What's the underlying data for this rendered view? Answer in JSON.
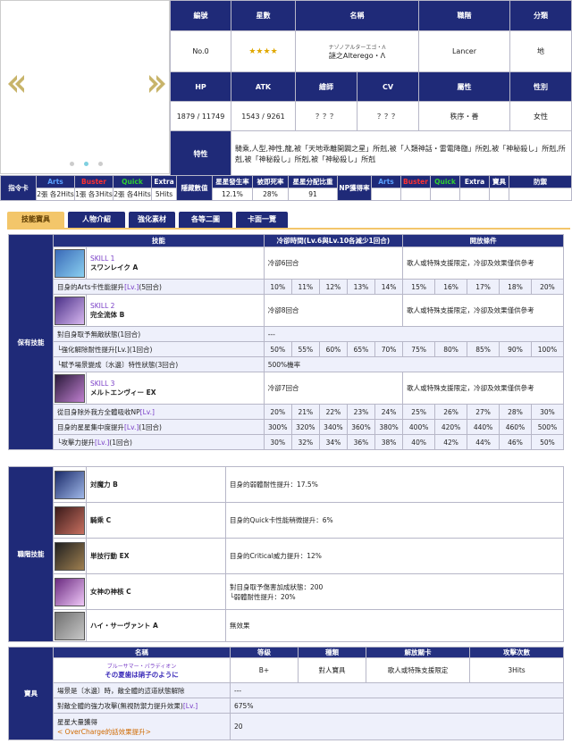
{
  "carousel": {
    "prev": "prev-arrow",
    "next": "next-arrow",
    "dots": 3,
    "active_dot": 1
  },
  "info": {
    "h_no": "編號",
    "h_star": "星數",
    "h_name": "名稱",
    "h_class": "職階",
    "h_cat": "分類",
    "no": "No.0",
    "stars": "★★★★",
    "name_jp": "ナゾノアルターエゴ・Λ",
    "name": "謎之Alterego・Λ",
    "class": "Lancer",
    "cat": "地",
    "h_hp": "HP",
    "h_atk": "ATK",
    "h_artist": "繪師",
    "h_cv": "CV",
    "h_attr": "屬性",
    "h_gender": "性別",
    "hp": "1879 / 11749",
    "atk": "1543 / 9261",
    "artist": "？？？",
    "cv": "？？？",
    "attr": "秩序・善",
    "gender": "女性",
    "h_trait": "特性",
    "trait": "騎乘,人型,神性,龍,被「天地乖離開闢之星」所剋,被「人類神話・雷電降臨」所剋,被「神秘殺し」所剋,所剋,被「神秘殺し」所剋,被「神秘殺し」所剋"
  },
  "cards": {
    "h_cmd": "指令卡",
    "arts": "Arts",
    "buster": "Buster",
    "quick": "Quick",
    "extra": "Extra",
    "arts_v": "2張 各2Hits",
    "buster_v": "1張 各3Hits",
    "quick_v": "2張 各4Hits",
    "extra_v": "5Hits",
    "h_hidden": "隱藏數值",
    "h_star_gen": "星星發生率",
    "h_death": "被即死率",
    "h_star_weight": "星星分配比重",
    "star_gen": "12.1%",
    "death": "28%",
    "star_weight": "91",
    "h_np": "NP獲得率",
    "np_arts": "Arts",
    "np_buster": "Buster",
    "np_quick": "Quick",
    "np_extra": "Extra",
    "np_np": "寶具",
    "np_def": "防禦"
  },
  "tabs": [
    "技能寶具",
    "人物介紹",
    "強化素材",
    "各等二圖",
    "卡面一覽"
  ],
  "skills": {
    "side": "保有技能",
    "h_skill": "技能",
    "h_cd": "冷卻時間(Lv.6與Lv.10各減少1回合)",
    "h_cond": "開放條件",
    "list": [
      {
        "tag": "SKILL 1",
        "name": "スワンレイク A",
        "cd": "冷卻6回合",
        "cond": "歌人或特殊支援限定，冷卻及效果僅供參考",
        "effects": [
          {
            "label": "目身的Arts卡性能提升[Lv.](5回合)",
            "vals": [
              "10%",
              "11%",
              "12%",
              "13%",
              "14%",
              "15%",
              "16%",
              "17%",
              "18%",
              "20%"
            ]
          }
        ]
      },
      {
        "tag": "SKILL 2",
        "name": "完全流体 B",
        "cd": "冷卻8回合",
        "cond": "歌人或特殊支援限定，冷卻及效果僅供參考",
        "effects": [
          {
            "label": "對自身取予無敵狀態(1回合)",
            "fixed": "---"
          },
          {
            "label": "└強化解除耐性提升[Lv.](1回合)",
            "vals": [
              "50%",
              "55%",
              "60%",
              "65%",
              "70%",
              "75%",
              "80%",
              "85%",
              "90%",
              "100%"
            ]
          },
          {
            "label": "└賦予場景變成〔水邊〕特性狀態(3回合)",
            "fixed": "500%機率"
          }
        ]
      },
      {
        "tag": "SKILL 3",
        "name": "メルトエンヴィー EX",
        "cd": "冷卻7回合",
        "cond": "歌人或特殊支援限定，冷卻及效果僅供參考",
        "effects": [
          {
            "label": "從目身除外我方全體吸收NP[Lv.]",
            "vals": [
              "20%",
              "21%",
              "22%",
              "23%",
              "24%",
              "25%",
              "26%",
              "27%",
              "28%",
              "30%"
            ]
          },
          {
            "label": "目身的星星集中度提升[Lv.](1回合)",
            "vals": [
              "300%",
              "320%",
              "340%",
              "360%",
              "380%",
              "400%",
              "420%",
              "440%",
              "460%",
              "500%"
            ]
          },
          {
            "label": "└攻擊力提升[Lv.](1回合)",
            "vals": [
              "30%",
              "32%",
              "34%",
              "36%",
              "38%",
              "40%",
              "42%",
              "44%",
              "46%",
              "50%"
            ]
          }
        ]
      }
    ]
  },
  "class_skills": {
    "side": "職階技能",
    "list": [
      {
        "name": "対魔力 B",
        "desc": "目身的弱體耐性提升：17.5%"
      },
      {
        "name": "騎乘 C",
        "desc": "目身的Quick卡性能稍微提升：6%"
      },
      {
        "name": "単技行動 EX",
        "desc": "目身的Critical威力提升：12%"
      },
      {
        "name": "女神の神核 C",
        "desc": "對目身取予傷害加成狀態：200",
        "desc2": "└弱體耐性提升：20%"
      },
      {
        "name": "ハイ・サーヴァント A",
        "desc": "無效果"
      }
    ]
  },
  "np": {
    "side": "寶具",
    "h_name": "名稱",
    "h_rank": "等級",
    "h_type": "種類",
    "h_unlock": "解放關卡",
    "h_hits": "攻擊次數",
    "ruby": "ブルーサマー・パラディオン",
    "name": "その夏歯は硝子のように",
    "rank": "B+",
    "type": "對人寶具",
    "unlock": "歌人或特殊支援限定",
    "hits": "3Hits",
    "rows": [
      {
        "label": "場景是〔水邊〕時，敵全體的這道狀態解除",
        "val": "---"
      },
      {
        "label": "對敵全體的強力攻擊(無視防禦力提升效果)[Lv.]",
        "val": "675%"
      },
      {
        "label": "星星大量獲得",
        "label2": "< OverCharge的話效果提升>",
        "val": "20"
      }
    ]
  }
}
